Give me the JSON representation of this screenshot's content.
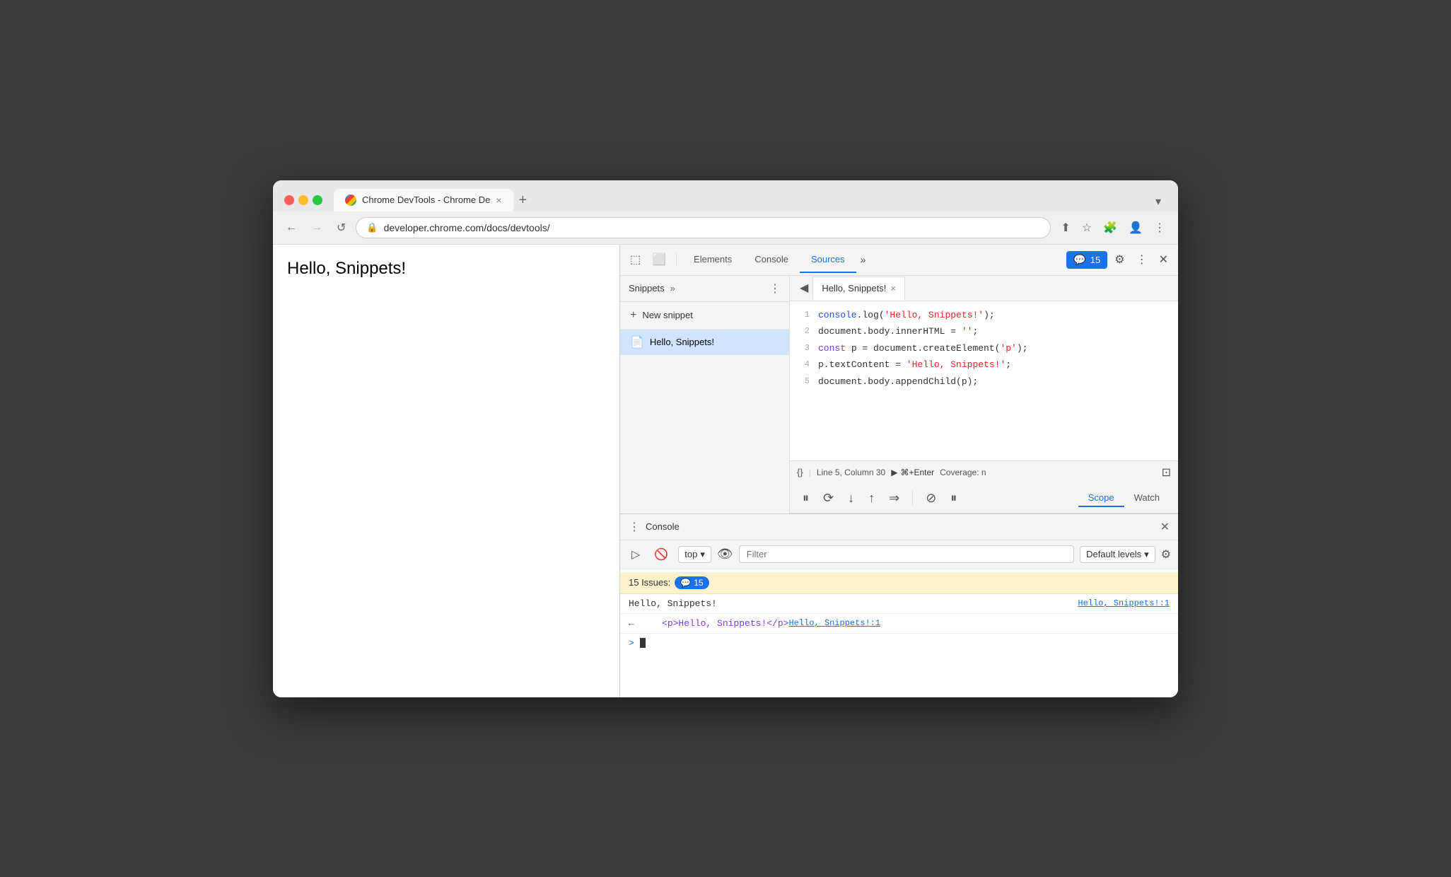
{
  "browser": {
    "tab": {
      "title": "Chrome DevTools - Chrome De",
      "favicon_label": "chrome-favicon",
      "close_label": "×",
      "new_tab_label": "+"
    },
    "nav": {
      "back_label": "←",
      "forward_label": "→",
      "reload_label": "↺",
      "url": "developer.chrome.com/docs/devtools/",
      "lock_icon": "🔒"
    }
  },
  "page": {
    "content": "Hello, Snippets!"
  },
  "devtools": {
    "toolbar": {
      "inspect_icon": "⬚",
      "device_icon": "⬜",
      "tabs": [
        "Elements",
        "Console",
        "Sources"
      ],
      "active_tab": "Sources",
      "more_tabs": "»",
      "badge_count": "15",
      "settings_icon": "⚙",
      "more_icon": "⋮",
      "close_icon": "✕"
    },
    "snippets_panel": {
      "title": "Snippets",
      "more_icon": "»",
      "menu_icon": "⋮",
      "new_snippet_label": "+ New snippet",
      "snippet_name": "Hello, Snippets!"
    },
    "editor": {
      "tab_title": "Hello, Snippets!",
      "back_icon": "◀",
      "close_icon": "×",
      "code_lines": [
        {
          "num": "1",
          "code": "console.log('Hello, Snippets!');",
          "parts": [
            {
              "text": "console",
              "class": "fn"
            },
            {
              "text": ".log(",
              "class": ""
            },
            {
              "text": "'Hello, Snippets!'",
              "class": "str"
            },
            {
              "text": ");",
              "class": ""
            }
          ]
        },
        {
          "num": "2",
          "code": "document.body.innerHTML = '';",
          "parts": [
            {
              "text": "document.body.innerHTML = ",
              "class": ""
            },
            {
              "text": "''",
              "class": "str"
            },
            {
              "text": ";",
              "class": ""
            }
          ]
        },
        {
          "num": "3",
          "code": "const p = document.createElement('p');",
          "parts": [
            {
              "text": "const ",
              "class": "kw"
            },
            {
              "text": "p = document.createElement(",
              "class": ""
            },
            {
              "text": "'p'",
              "class": "str"
            },
            {
              "text": ");",
              "class": ""
            }
          ]
        },
        {
          "num": "4",
          "code": "p.textContent = 'Hello, Snippets!';",
          "parts": [
            {
              "text": "p.textContent = ",
              "class": ""
            },
            {
              "text": "'Hello, Snippets!'",
              "class": "str"
            },
            {
              "text": ";",
              "class": ""
            }
          ]
        },
        {
          "num": "5",
          "code": "document.body.appendChild(p);",
          "parts": [
            {
              "text": "document.body.appendChild(p);",
              "class": ""
            }
          ]
        }
      ],
      "status_bar": {
        "format_icon": "{}",
        "location": "Line 5, Column 30",
        "run_icon": "▶",
        "run_shortcut": "⌘+Enter",
        "coverage_label": "Coverage: n",
        "dropdown_icon": "⊡"
      }
    },
    "debugger": {
      "pause_icon": "⏸",
      "step_over_icon": "⟳",
      "step_into_icon": "↓",
      "step_out_icon": "↑",
      "step_icon": "⇒",
      "deactivate_icon": "⊘",
      "pause_exceptions_icon": "⏸",
      "tabs": [
        "Scope",
        "Watch"
      ],
      "active_tab": "Scope"
    },
    "console": {
      "title": "Console",
      "menu_icon": "⋮",
      "close_icon": "✕",
      "toolbar": {
        "execute_icon": "▷",
        "clear_icon": "🚫",
        "context_label": "top",
        "context_arrow": "▾",
        "eye_icon": "👁",
        "filter_placeholder": "Filter",
        "levels_label": "Default levels",
        "levels_arrow": "▾",
        "gear_icon": "⚙"
      },
      "issues_count": "15 Issues:",
      "issues_badge": "15",
      "log_lines": [
        {
          "text": "Hello, Snippets!",
          "source": "Hello, Snippets!:1"
        },
        {
          "html": "<p>Hello, Snippets!</p>",
          "source": "Hello, Snippets!:1"
        }
      ],
      "prompt_arrow": ">"
    }
  }
}
